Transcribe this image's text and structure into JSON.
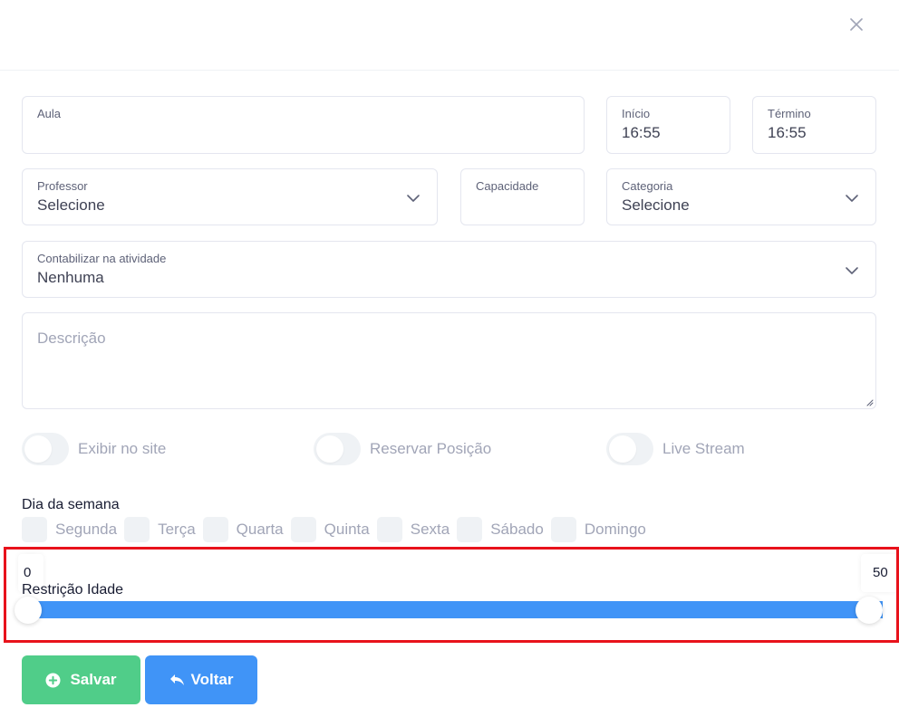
{
  "form": {
    "aula": {
      "label": "Aula",
      "value": ""
    },
    "inicio": {
      "label": "Início",
      "value": "16:55"
    },
    "termino": {
      "label": "Término",
      "value": "16:55"
    },
    "professor": {
      "label": "Professor",
      "value": "Selecione"
    },
    "capacidade": {
      "label": "Capacidade",
      "value": ""
    },
    "categoria": {
      "label": "Categoria",
      "value": "Selecione"
    },
    "contabilizar": {
      "label": "Contabilizar na atividade",
      "value": "Nenhuma"
    },
    "descricao": {
      "placeholder": "Descrição"
    }
  },
  "toggles": [
    {
      "label": "Exibir no site",
      "on": false
    },
    {
      "label": "Reservar Posição",
      "on": false
    },
    {
      "label": "Live Stream",
      "on": false
    }
  ],
  "dias": {
    "title": "Dia da semana",
    "items": [
      {
        "label": "Segunda",
        "checked": false
      },
      {
        "label": "Terça",
        "checked": false
      },
      {
        "label": "Quarta",
        "checked": false
      },
      {
        "label": "Quinta",
        "checked": false
      },
      {
        "label": "Sexta",
        "checked": false
      },
      {
        "label": "Sábado",
        "checked": false
      },
      {
        "label": "Domingo",
        "checked": false
      }
    ]
  },
  "idade": {
    "label": "Restrição Idade",
    "min_label": "0",
    "max_label": "50",
    "range_min": 0,
    "range_max": 50,
    "low": 0,
    "high": 50
  },
  "buttons": {
    "save": "Salvar",
    "back": "Voltar"
  },
  "icons": {
    "close": "close-icon",
    "chevron": "chevron-down-icon",
    "save": "plus-circle-icon",
    "back": "undo-arrow-icon"
  },
  "colors": {
    "save": "#50cd89",
    "primary": "#4094f7",
    "highlight": "#e8121b"
  }
}
